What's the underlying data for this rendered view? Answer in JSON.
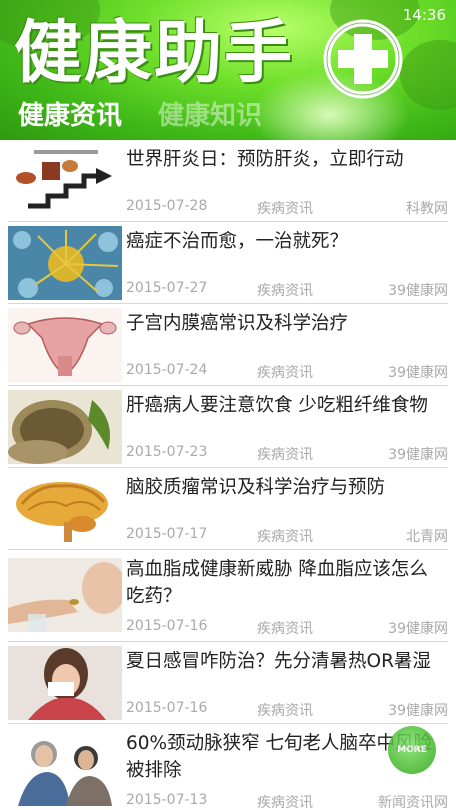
{
  "status_bar": {
    "time": "14:36"
  },
  "header": {
    "title": "健康助手",
    "tabs": [
      {
        "label": "健康资讯",
        "active": true
      },
      {
        "label": "健康知识",
        "active": false
      }
    ]
  },
  "news": [
    {
      "title": "世界肝炎日：预防肝炎，立即行动",
      "date": "2015-07-28",
      "category": "疾病资讯",
      "source": "科教网",
      "thumb": "liver-diagram"
    },
    {
      "title": "癌症不治而愈，一治就死？",
      "date": "2015-07-27",
      "category": "疾病资讯",
      "source": "39健康网",
      "thumb": "cancer-cell"
    },
    {
      "title": "子宫内膜癌常识及科学治疗",
      "date": "2015-07-24",
      "category": "疾病资讯",
      "source": "39健康网",
      "thumb": "uterus-diagram"
    },
    {
      "title": "肝癌病人要注意饮食 少吃粗纤维食物",
      "date": "2015-07-23",
      "category": "疾病资讯",
      "source": "39健康网",
      "thumb": "grains-basket"
    },
    {
      "title": "脑胶质瘤常识及科学治疗与预防",
      "date": "2015-07-17",
      "category": "疾病资讯",
      "source": "北青网",
      "thumb": "brain-diagram"
    },
    {
      "title": "高血脂成健康新威胁 降血脂应该怎么吃药？",
      "date": "2015-07-16",
      "category": "疾病资讯",
      "source": "39健康网",
      "thumb": "taking-pill"
    },
    {
      "title": "夏日感冒咋防治？先分清暑热OR暑湿",
      "date": "2015-07-16",
      "category": "疾病资讯",
      "source": "39健康网",
      "thumb": "woman-sneezing"
    },
    {
      "title": "60%颈动脉狭窄 七旬老人脑卒中风险被排除",
      "date": "2015-07-13",
      "category": "疾病资讯",
      "source": "新闻资讯网",
      "thumb": "elderly-couple"
    }
  ],
  "more_button": {
    "label": "MORE"
  },
  "colors": {
    "accent": "#4cc41f",
    "divider": "#bfe9b6",
    "meta_text": "#a9a9a9"
  }
}
